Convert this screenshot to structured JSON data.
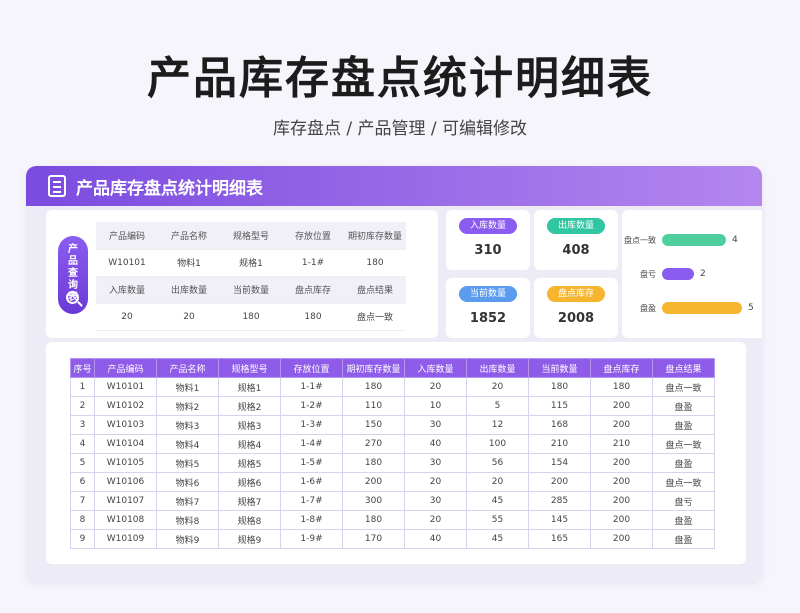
{
  "page": {
    "title": "产品库存盘点统计明细表",
    "breadcrumb": "库存盘点 / 产品管理 /  可编辑修改"
  },
  "card": {
    "title": "产品库存盘点统计明细表"
  },
  "query": {
    "button_label": "产品查询表",
    "headers1": [
      "产品编码",
      "产品名称",
      "规格型号",
      "存放位置",
      "期初库存数量"
    ],
    "values1": [
      "W10101",
      "物料1",
      "规格1",
      "1-1#",
      "180"
    ],
    "headers2": [
      "入库数量",
      "出库数量",
      "当前数量",
      "盘点库存",
      "盘点结果"
    ],
    "values2": [
      "20",
      "20",
      "180",
      "180",
      "盘点一致"
    ]
  },
  "stats": [
    {
      "label": "入库数量",
      "value": "310",
      "color": "#8b5cf0"
    },
    {
      "label": "出库数量",
      "value": "408",
      "color": "#2fc6a0"
    },
    {
      "label": "当前数量",
      "value": "1852",
      "color": "#5b9bf0"
    },
    {
      "label": "盘点库存",
      "value": "2008",
      "color": "#f6b52e"
    }
  ],
  "summary_bars": [
    {
      "label": "盘点一致",
      "value": 4,
      "value_text": "4",
      "color": "#4ecf9e"
    },
    {
      "label": "盘亏",
      "value": 2,
      "value_text": "2",
      "color": "#8b5cf0"
    },
    {
      "label": "盘盈",
      "value": 5,
      "value_text": "5",
      "color": "#f6b52e"
    }
  ],
  "table": {
    "headers": [
      "序号",
      "产品编码",
      "产品名称",
      "规格型号",
      "存放位置",
      "期初库存数量",
      "入库数量",
      "出库数量",
      "当前数量",
      "盘点库存",
      "盘点结果"
    ],
    "rows": [
      [
        "1",
        "W10101",
        "物料1",
        "规格1",
        "1-1#",
        "180",
        "20",
        "20",
        "180",
        "180",
        "盘点一致"
      ],
      [
        "2",
        "W10102",
        "物料2",
        "规格2",
        "1-2#",
        "110",
        "10",
        "5",
        "115",
        "200",
        "盘盈"
      ],
      [
        "3",
        "W10103",
        "物料3",
        "规格3",
        "1-3#",
        "150",
        "30",
        "12",
        "168",
        "200",
        "盘盈"
      ],
      [
        "4",
        "W10104",
        "物料4",
        "规格4",
        "1-4#",
        "270",
        "40",
        "100",
        "210",
        "210",
        "盘点一致"
      ],
      [
        "5",
        "W10105",
        "物料5",
        "规格5",
        "1-5#",
        "180",
        "30",
        "56",
        "154",
        "200",
        "盘盈"
      ],
      [
        "6",
        "W10106",
        "物料6",
        "规格6",
        "1-6#",
        "200",
        "20",
        "20",
        "200",
        "200",
        "盘点一致"
      ],
      [
        "7",
        "W10107",
        "物料7",
        "规格7",
        "1-7#",
        "300",
        "30",
        "45",
        "285",
        "200",
        "盘亏"
      ],
      [
        "8",
        "W10108",
        "物料8",
        "规格8",
        "1-8#",
        "180",
        "20",
        "55",
        "145",
        "200",
        "盘盈"
      ],
      [
        "9",
        "W10109",
        "物料9",
        "规格9",
        "1-9#",
        "170",
        "40",
        "45",
        "165",
        "200",
        "盘盈"
      ]
    ]
  }
}
